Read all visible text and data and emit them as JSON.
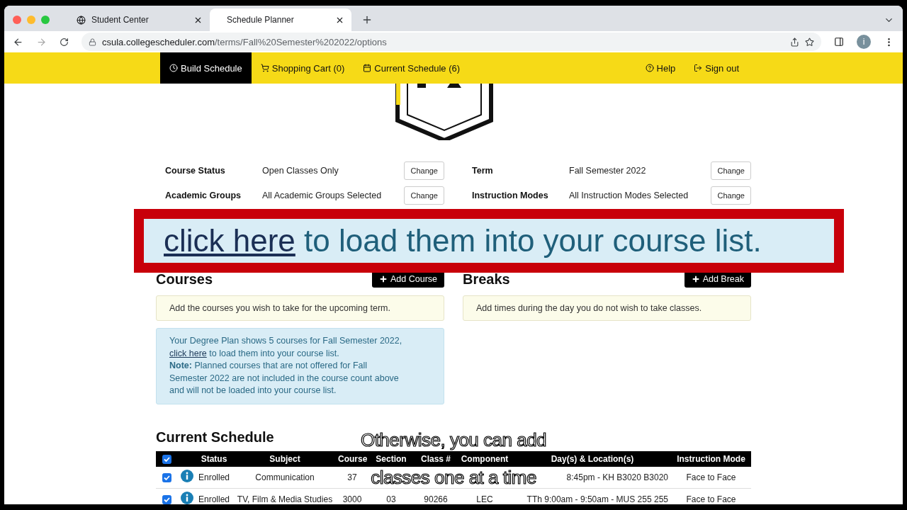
{
  "browser": {
    "tabs": [
      {
        "title": "Student Center",
        "selected": false
      },
      {
        "title": "Schedule Planner",
        "selected": true
      }
    ],
    "url_host": "csula.collegescheduler.com",
    "url_path": "/terms/Fall%20Semester%202022/options",
    "profile_initial": "i"
  },
  "nav": {
    "left": [
      {
        "label": "Build Schedule",
        "kind": "clock",
        "selected": true
      },
      {
        "label": "Shopping Cart (0)",
        "kind": "cart",
        "selected": false
      },
      {
        "label": "Current Schedule (6)",
        "kind": "calendar",
        "selected": false
      }
    ],
    "right": [
      {
        "label": "Help",
        "kind": "help"
      },
      {
        "label": "Sign out",
        "kind": "signout"
      }
    ]
  },
  "options": [
    {
      "label": "Course Status",
      "value": "Open Classes Only",
      "button": "Change"
    },
    {
      "label": "Term",
      "value": "Fall Semester 2022",
      "button": "Change"
    },
    {
      "label": "Academic Groups",
      "value": "All Academic Groups Selected",
      "button": "Change"
    },
    {
      "label": "Instruction Modes",
      "value": "All Instruction Modes Selected",
      "button": "Change"
    }
  ],
  "courses": {
    "title": "Courses",
    "add_button": "Add Course",
    "hint": "Add the courses you wish to take for the upcoming term.",
    "degree_plan": {
      "text_before": "Your Degree Plan shows 5 courses for Fall Semester 2022,",
      "link": "click here",
      "text_after": " to load them into your course list.",
      "note": "**Note:** Planned courses that are not offered for Fall Semester 2022 are not included in the course count above and will not be loaded into your course list."
    }
  },
  "breaks": {
    "title": "Breaks",
    "add_button": "Add Break",
    "hint": "Add times during the day you do not wish to take classes."
  },
  "schedule": {
    "title": "Current Schedule",
    "all_checked": true,
    "columns": [
      "Status",
      "Subject",
      "Course",
      "Section",
      "Class #",
      "Component",
      "Day(s) & Location(s)",
      "Instruction Mode"
    ],
    "rows": [
      {
        "checked": true,
        "status": "Enrolled",
        "subject": "Communication",
        "course": "37",
        "days": "8:45pm - KH B3020 B3020",
        "mode": "Face to Face"
      },
      {
        "checked": true,
        "status": "Enrolled",
        "subject": "TV, Film & Media Studies",
        "course": "3000",
        "section": "03",
        "class_no": "90266",
        "component": "LEC",
        "days": "TTh 9:00am - 9:50am - MUS 255 255",
        "mode": "Face to Face"
      }
    ]
  },
  "zoom_callout": {
    "link": "click here",
    "text": " to load them into your course list."
  },
  "caption": [
    "Otherwise, you can add",
    "classes one at a time"
  ]
}
